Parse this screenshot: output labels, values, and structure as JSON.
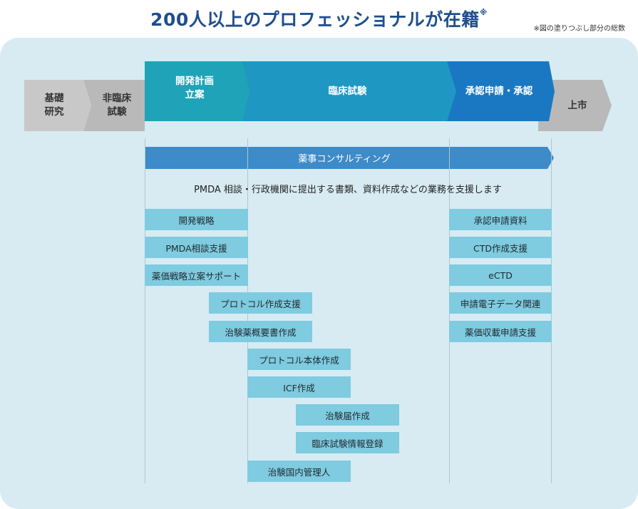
{
  "title": {
    "main": "200人以上のプロフェッショナルが在籍",
    "mark": "※"
  },
  "note": "※図の塗りつぶし部分の総数",
  "stages": [
    {
      "label": "基礎\n研究"
    },
    {
      "label": "非臨床\n試験"
    },
    {
      "label": "開発計画\n立案"
    },
    {
      "label": "臨床試験"
    },
    {
      "label": "承認申請・承認"
    },
    {
      "label": "上市"
    }
  ],
  "consulting": {
    "label": "薬事コンサルティング",
    "description": "PMDA 相談・行政機関に提出する書類、資料作成などの業務を支援します"
  },
  "services": [
    "開発戦略",
    "PMDA相談支援",
    "薬価戦略立案サポート",
    "プロトコル作成支援",
    "治験薬概要書作成",
    "プロトコル本体作成",
    "ICF作成",
    "治験届作成",
    "臨床試験情報登録",
    "治験国内管理人",
    "承認申請資料",
    "CTD作成支援",
    "eCTD",
    "申請電子データ関連",
    "薬価収載申請支援"
  ],
  "colors": {
    "title": "#1f4e8c",
    "panel": "#d8ebf3",
    "stage_gray": "#c8c8c8",
    "stage_gray_dark": "#b9b9b9",
    "stage_teal": "#1fa3b9",
    "stage_blue": "#1d8fc2",
    "stage_blue_dark": "#1a78c2",
    "consulting_bar": "#3d8bc8",
    "service_box": "#7fcbe0"
  }
}
